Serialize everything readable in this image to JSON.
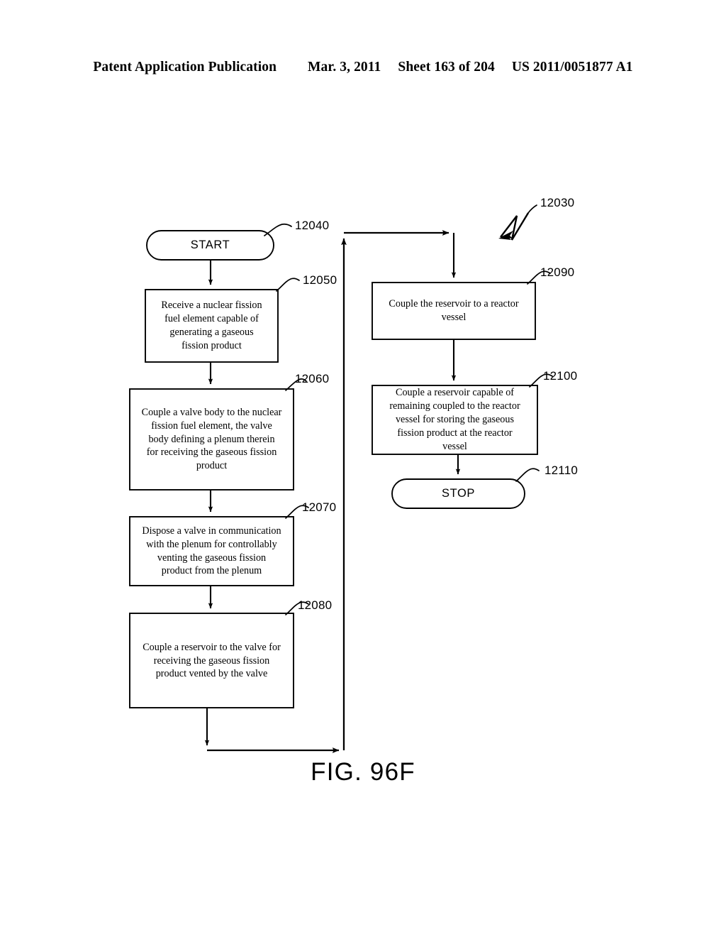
{
  "header": {
    "publication": "Patent Application Publication",
    "date": "Mar. 3, 2011",
    "sheet": "Sheet 163 of 204",
    "docnum": "US 2011/0051877 A1"
  },
  "figure": {
    "caption": "FIG. 96F",
    "diagram_ref": "12030"
  },
  "nodes": [
    {
      "id": "start",
      "ref": "12040",
      "shape": "terminator",
      "label": "START"
    },
    {
      "id": "step-12050",
      "ref": "12050",
      "shape": "process",
      "label": "Receive a nuclear fission fuel element capable of generating a gaseous fission product",
      "lines": [
        "Receive a nuclear fission",
        "fuel element capable of",
        "generating a gaseous",
        "fission product"
      ]
    },
    {
      "id": "step-12060",
      "ref": "12060",
      "shape": "process",
      "label": "Couple a valve body to the nuclear fission fuel element, the valve body defining a plenum therein for receiving the gaseous fission product",
      "lines": [
        "Couple a valve body to the nuclear",
        "fission fuel element, the valve",
        "body defining a plenum therein",
        "for receiving the gaseous fission",
        "product"
      ]
    },
    {
      "id": "step-12070",
      "ref": "12070",
      "shape": "process",
      "label": "Dispose a valve in communication with the plenum for controllably venting the gaseous fission product from the plenum",
      "lines": [
        "Dispose a valve in communication",
        "with the plenum for controllably",
        "venting the gaseous fission",
        "product from the plenum"
      ]
    },
    {
      "id": "step-12080",
      "ref": "12080",
      "shape": "process",
      "label": "Couple a reservoir to the valve for receiving the gaseous fission product vented by the valve",
      "lines": [
        "Couple a reservoir to the valve for",
        "receiving the gaseous fission",
        "product vented by the valve"
      ]
    },
    {
      "id": "step-12090",
      "ref": "12090",
      "shape": "process",
      "label": "Couple the reservoir to a reactor vessel",
      "lines": [
        "Couple the reservoir to a reactor",
        "vessel"
      ]
    },
    {
      "id": "step-12100",
      "ref": "12100",
      "shape": "process",
      "label": "Couple a reservoir capable of remaining coupled to the reactor vessel for storing the gaseous fission product at the reactor vessel",
      "lines": [
        "Couple a reservoir capable of",
        "remaining coupled to the reactor",
        "vessel for storing the gaseous",
        "fission product at the reactor",
        "vessel"
      ]
    },
    {
      "id": "stop",
      "ref": "12110",
      "shape": "terminator",
      "label": "STOP"
    }
  ],
  "text": {
    "start_label": "START",
    "stop_label": "STOP",
    "l12050": "Receive a nuclear fission\nfuel element capable of\ngenerating a gaseous\nfission product",
    "l12060": "Couple a valve body to the nuclear\nfission fuel element, the valve\nbody defining a plenum therein\nfor receiving the gaseous fission\nproduct",
    "l12070": "Dispose a valve in communication\nwith the plenum for controllably\nventing the gaseous fission\nproduct from the plenum",
    "l12080": "Couple a reservoir to the valve for\nreceiving the gaseous fission\nproduct vented by the valve",
    "l12090": "Couple the reservoir to a reactor\nvessel",
    "l12100": "Couple a reservoir capable of\nremaining coupled to the reactor\nvessel for storing the gaseous\nfission product at the reactor\nvessel"
  },
  "refs": {
    "r12030": "12030",
    "r12040": "12040",
    "r12050": "12050",
    "r12060": "12060",
    "r12070": "12070",
    "r12080": "12080",
    "r12090": "12090",
    "r12100": "12100",
    "r12110": "12110"
  },
  "colors": {
    "ink": "#000000",
    "paper": "#ffffff"
  }
}
